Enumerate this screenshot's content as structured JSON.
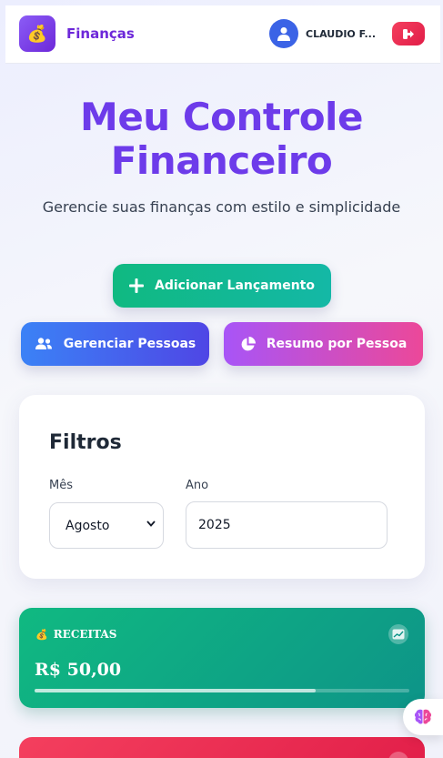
{
  "header": {
    "brand_emoji": "💰",
    "brand_name": "Finanças",
    "user_name": "CLAUDIO F...",
    "logout_icon": "sign-out-icon"
  },
  "hero": {
    "title": "Meu Controle Financeiro",
    "subtitle": "Gerencie suas finanças com estilo e simplicidade"
  },
  "actions": {
    "add_label": "Adicionar Lançamento",
    "people_label": "Gerenciar Pessoas",
    "summary_label": "Resumo por Pessoa"
  },
  "filters": {
    "title": "Filtros",
    "month_label": "Mês",
    "month_value": "Agosto",
    "year_label": "Ano",
    "year_value": "2025"
  },
  "income_card": {
    "emoji": "💰",
    "label": "RECEITAS",
    "value": "R$ 50,00",
    "progress": 0.75
  },
  "colors": {
    "accent": "#6d3bea",
    "income": "#10b981",
    "expense": "#e11d48",
    "people": "#3b82f6",
    "summary": "#a855f7"
  }
}
